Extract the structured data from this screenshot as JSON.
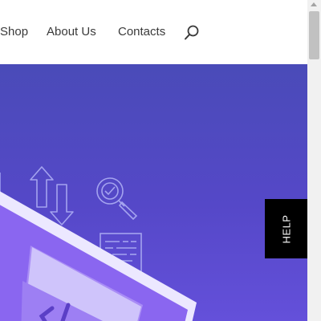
{
  "nav": {
    "items": [
      {
        "label": "Shop"
      },
      {
        "label": "About Us"
      },
      {
        "label": "Contacts"
      }
    ],
    "search_icon": "search-icon"
  },
  "help": {
    "label": "HELP"
  },
  "colors": {
    "hero_top": "#4a4bb8",
    "hero_bottom": "#6450da",
    "laptop_body": "#8a66f0",
    "help_bg": "#000000",
    "nav_text": "#3a3a3a"
  },
  "icons": [
    "transfer-arrows-icon",
    "magnifier-check-icon",
    "document-lines-icon",
    "laptop-code-illustration"
  ]
}
